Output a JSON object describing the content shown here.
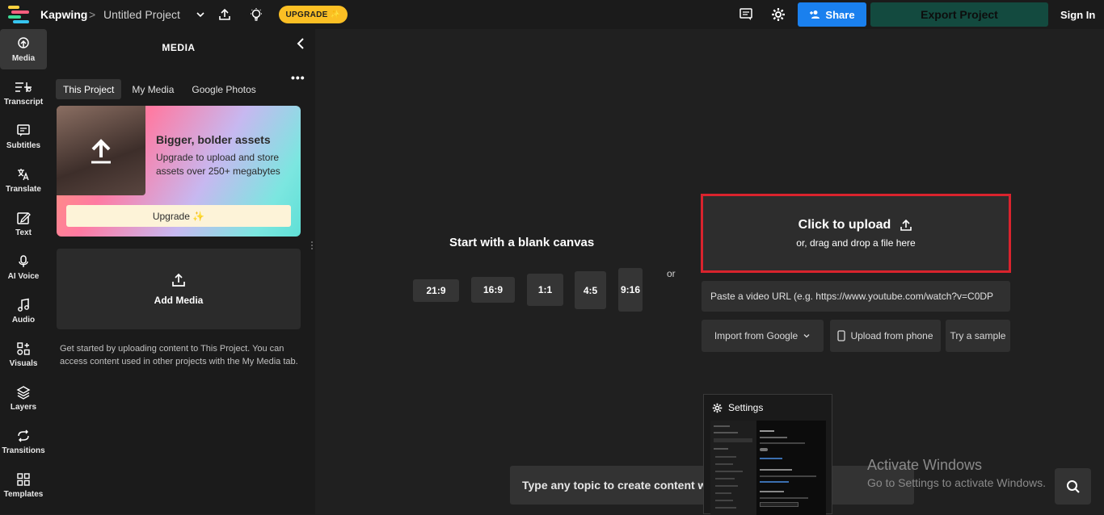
{
  "topbar": {
    "brand": "Kapwing",
    "separator": ">",
    "project_title": "Untitled Project",
    "upgrade_label": "UPGRADE ✨",
    "share_label": "Share",
    "export_label": "Export Project",
    "signin_label": "Sign In",
    "icons": [
      "kapwing-logo-icon",
      "chevron-down-icon",
      "upload-icon",
      "lightbulb-icon",
      "comments-icon",
      "gear-icon",
      "add-person-icon"
    ]
  },
  "rail": {
    "items": [
      {
        "label": "Media",
        "icon": "upload-cloud-icon",
        "active": true
      },
      {
        "label": "Transcript",
        "icon": "transcript-icon"
      },
      {
        "label": "Subtitles",
        "icon": "subtitles-icon"
      },
      {
        "label": "Translate",
        "icon": "translate-icon"
      },
      {
        "label": "Text",
        "icon": "text-edit-icon"
      },
      {
        "label": "AI Voice",
        "icon": "microphone-icon"
      },
      {
        "label": "Audio",
        "icon": "music-note-icon"
      },
      {
        "label": "Visuals",
        "icon": "visuals-grid-icon"
      },
      {
        "label": "Layers",
        "icon": "layers-icon"
      },
      {
        "label": "Transitions",
        "icon": "transitions-icon"
      },
      {
        "label": "Templates",
        "icon": "templates-grid-icon"
      }
    ]
  },
  "panel": {
    "title": "MEDIA",
    "tabs": [
      {
        "label": "This Project",
        "active": true
      },
      {
        "label": "My Media"
      },
      {
        "label": "Google Photos"
      }
    ],
    "more_label": "•••",
    "promo": {
      "heading": "Bigger, bolder assets",
      "body": "Upgrade to upload and store assets over 250+ megabytes",
      "button": "Upgrade ✨"
    },
    "add_media_label": "Add Media",
    "help_text": "Get started by uploading content to This Project. You can access content used in other projects with the My Media tab."
  },
  "main": {
    "blank_canvas_title": "Start with a blank canvas",
    "ratios": [
      "21:9",
      "16:9",
      "1:1",
      "4:5",
      "9:16"
    ],
    "or_label": "or",
    "upload": {
      "heading": "Click to upload",
      "subheading": "or, drag and drop a file here"
    },
    "url_placeholder": "Paste a video URL (e.g. https://www.youtube.com/watch?v=C0DP",
    "import_google_label": "Import from Google",
    "upload_phone_label": "Upload from phone",
    "try_sample_label": "Try a sample",
    "prompt_placeholder": "Type any topic to create content w"
  },
  "settings_thumbnail": {
    "title": "Settings"
  },
  "watermark": {
    "line1": "Activate Windows",
    "line2": "Go to Settings to activate Windows."
  },
  "colors": {
    "share": "#1a80ee",
    "export": "#134a3f",
    "upgrade": "#fbbf24",
    "highlight": "#d9232d"
  }
}
